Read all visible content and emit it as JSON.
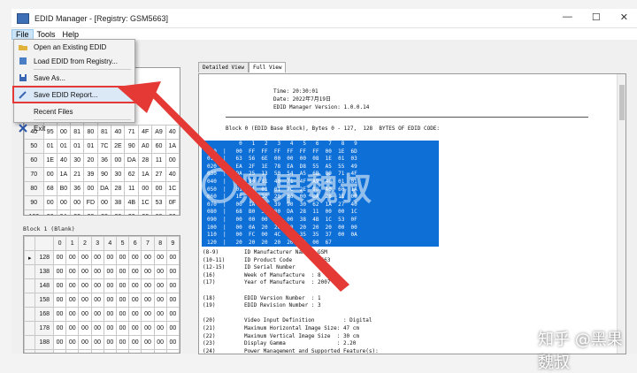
{
  "window": {
    "title": "EDID Manager - [Registry: GSM5663]"
  },
  "menubar": [
    "File",
    "Tools",
    "Help"
  ],
  "file_menu": {
    "items": [
      {
        "label": "Open an Existing EDID",
        "icon": "folder-open-icon"
      },
      {
        "label": "Load EDID from Registry...",
        "icon": "registry-icon"
      },
      {
        "label": "Save As...",
        "icon": "save-icon"
      },
      {
        "label": "Save EDID Report...",
        "icon": "report-icon"
      },
      {
        "label": "Recent Files",
        "icon": ""
      },
      {
        "label": "Exit",
        "icon": "exit-icon"
      }
    ]
  },
  "block0": {
    "header": [
      "8",
      "9"
    ],
    "rows": [
      {
        "addr": "",
        "cells": [
          "F",
          "00",
          "1E",
          "6D"
        ]
      },
      {
        "addr": "",
        "cells": [
          "",
          "",
          "01",
          "03"
        ]
      },
      {
        "addr": "",
        "cells": [
          "",
          "",
          "55",
          "49"
        ]
      },
      {
        "addr": "",
        "cells": [
          "",
          "",
          "",
          "0F"
        ]
      },
      {
        "addr": "40",
        "cells": [
          "95",
          "00",
          "81",
          "80",
          "81",
          "40",
          "71",
          "4F",
          "A9",
          "40"
        ]
      },
      {
        "addr": "50",
        "cells": [
          "01",
          "01",
          "01",
          "01",
          "7C",
          "2E",
          "90",
          "A0",
          "60",
          "1A"
        ]
      },
      {
        "addr": "60",
        "cells": [
          "1E",
          "40",
          "30",
          "20",
          "36",
          "00",
          "DA",
          "28",
          "11",
          "00"
        ]
      },
      {
        "addr": "70",
        "cells": [
          "00",
          "1A",
          "21",
          "39",
          "90",
          "30",
          "62",
          "1A",
          "27",
          "40"
        ]
      },
      {
        "addr": "80",
        "cells": [
          "68",
          "B0",
          "36",
          "00",
          "DA",
          "28",
          "11",
          "00",
          "00",
          "1C"
        ]
      },
      {
        "addr": "90",
        "cells": [
          "00",
          "00",
          "00",
          "FD",
          "00",
          "38",
          "4B",
          "1C",
          "53",
          "0F"
        ]
      },
      {
        "addr": "100",
        "cells": [
          "00",
          "0A",
          "20",
          "20",
          "20",
          "20",
          "20",
          "20",
          "00",
          "00"
        ]
      }
    ]
  },
  "block1": {
    "label": "Block 1 (Blank)",
    "header": [
      "",
      "0",
      "1",
      "2",
      "3",
      "4",
      "5",
      "6",
      "7",
      "8",
      "9"
    ],
    "rows": [
      {
        "addr": "128",
        "cells": [
          "00",
          "00",
          "00",
          "00",
          "00",
          "00",
          "00",
          "00",
          "00",
          "00"
        ]
      },
      {
        "addr": "138",
        "cells": [
          "00",
          "00",
          "00",
          "00",
          "00",
          "00",
          "00",
          "00",
          "00",
          "00"
        ]
      },
      {
        "addr": "148",
        "cells": [
          "00",
          "00",
          "00",
          "00",
          "00",
          "00",
          "00",
          "00",
          "00",
          "00"
        ]
      },
      {
        "addr": "158",
        "cells": [
          "00",
          "00",
          "00",
          "00",
          "00",
          "00",
          "00",
          "00",
          "00",
          "00"
        ]
      },
      {
        "addr": "168",
        "cells": [
          "00",
          "00",
          "00",
          "00",
          "00",
          "00",
          "00",
          "00",
          "00",
          "00"
        ]
      },
      {
        "addr": "178",
        "cells": [
          "00",
          "00",
          "00",
          "00",
          "00",
          "00",
          "00",
          "00",
          "00",
          "00"
        ]
      },
      {
        "addr": "188",
        "cells": [
          "00",
          "00",
          "00",
          "00",
          "00",
          "00",
          "00",
          "00",
          "00",
          "00"
        ]
      },
      {
        "addr": "198",
        "cells": [
          "00",
          "00",
          "00",
          "00",
          "00",
          "00",
          "00",
          "00",
          "00",
          "00"
        ]
      }
    ]
  },
  "tabs": [
    "Detailed View",
    "Full View"
  ],
  "report": {
    "time": "Time: 20:30:01",
    "date": "Date: 2022年7月19日",
    "version": "EDID Manager Version: 1.0.0.14",
    "block_header": "Block 0 (EDID Base Block), Bytes 0 - 127,  128  BYTES OF EDID CODE:",
    "hex": "          0   1   2   3   4   5   6   7   8   9\n000  |   00  FF  FF  FF  FF  FF  FF  00  1E  6D\n010  |   63  56  6E  00  00  00  08  1E  01  03\n020  |   EA  2F  1E  78  EA  D8  55  A5  55  49\n030  |   9A  25  13  50  54  A5  6B  80  71  4F\n040  |   81  80  81  40  71  4F  A9  40  01  01\n050  |   01  01  01  01  7C  2E  90  A0  60  1A\n060  |   1E  40  30  20  36  00  DA  28  11  00\n070  |   00  1A  21  39  90  30  62  1A  27  40\n080  |   68  B0  36  00  DA  28  11  00  00  1C\n090  |   00  00  00  FD  00  38  4B  1C  53  0F\n100  |   00  0A  20  20  20  20  20  20  00  00\n110  |   00  FC  00  4C  32  35  35  37  00  0A\n120  |   20  20  20  20  20  00  00  67",
    "fields": "(8-9)        ID Manufacturer Name : GSM\n(10-11)      ID Product Code      : 5663\n(12-15)      ID Serial Number\n(16)         Week of Manufacture  : 8\n(17)         Year of Manufacture  : 2007\n\n(18)         EDID Version Number  : 1\n(19)         EDID Revision Number : 3\n\n(20)         Video Input Definition         : Digital\n(21)         Maximum Horizontal Image Size: 47 cm\n(22)         Maximum Vertical Image Size  : 30 cm\n(23)         Display Gamma                : 2.20\n(24)         Power Management and Supported Feature(s):"
  },
  "watermark": {
    "text": "黑果魏叔",
    "footer": "知乎 @黑果魏叔"
  },
  "colors": {
    "selection": "#0e6fd6",
    "highlight": "#e53935"
  }
}
